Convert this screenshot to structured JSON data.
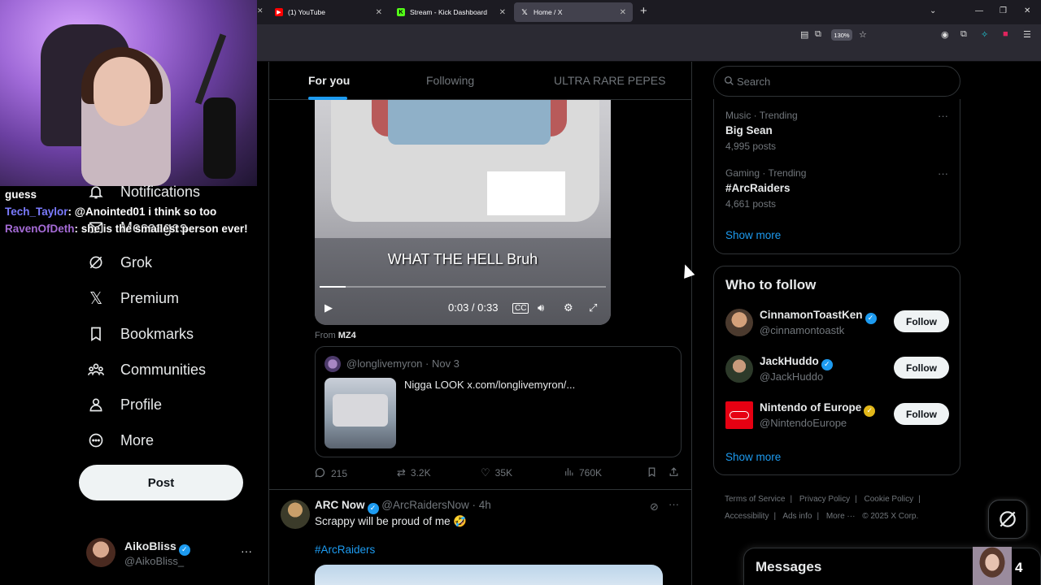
{
  "browser": {
    "tabs": [
      {
        "label": "(1) YouTube",
        "icon": "youtube-icon",
        "color": "#ff0000"
      },
      {
        "label": "Stream - Kick Dashboard",
        "icon": "kick-icon",
        "color": "#53fc18"
      },
      {
        "label": "Home / X",
        "icon": "x-logo-icon",
        "color": "#ffffff"
      }
    ],
    "zoom": "130%"
  },
  "chat": [
    {
      "user": "",
      "text": "guess"
    },
    {
      "user": "Tech_Taylor",
      "text": "@Anointed01 i think so too"
    },
    {
      "user": "RavenOfDeth",
      "text": "she is the smallest person ever!"
    }
  ],
  "nav": {
    "items": [
      {
        "label": "Notifications",
        "icon": "bell-icon"
      },
      {
        "label": "Messages",
        "icon": "envelope-icon"
      },
      {
        "label": "Grok",
        "icon": "grok-icon"
      },
      {
        "label": "Premium",
        "icon": "x-logo-icon"
      },
      {
        "label": "Bookmarks",
        "icon": "bookmark-icon"
      },
      {
        "label": "Communities",
        "icon": "people-icon"
      },
      {
        "label": "Profile",
        "icon": "person-icon"
      },
      {
        "label": "More",
        "icon": "more-circle-icon"
      }
    ],
    "post_label": "Post",
    "account": {
      "name": "AikoBliss",
      "handle": "@AikoBliss_"
    }
  },
  "timeline": {
    "tabs": [
      "For you",
      "Following",
      "ULTRA RARE PEPES"
    ],
    "active_tab": 0,
    "video": {
      "caption": "WHAT THE HELL Bruh",
      "time": "0:03 / 0:33",
      "progress": 0.09
    },
    "from_prefix": "From",
    "from_account": "MZ4",
    "quote": {
      "head": "@longlivemyron · Nov 3",
      "text": "Nigga LOOK  x.com/longlivemyron/..."
    },
    "stats": {
      "replies": "215",
      "reposts": "3.2K",
      "likes": "35K",
      "views": "760K"
    },
    "tweet2": {
      "name": "ARC Now",
      "handle": "@ArcRaidersNow · 4h",
      "text": "Scrappy will be proud of me 🤣",
      "hashtag": "#ArcRaiders"
    }
  },
  "sidebar": {
    "search_placeholder": "Search",
    "trends": [
      {
        "category": "Music · Trending",
        "name": "Big Sean",
        "posts": "4,995 posts"
      },
      {
        "category": "Gaming · Trending",
        "name": "#ArcRaiders",
        "posts": "4,661 posts"
      }
    ],
    "trends_show_more": "Show more",
    "who_to_follow_title": "Who to follow",
    "who_to_follow": [
      {
        "name": "CinnamonToastKen",
        "handle": "@cinnamontoastk",
        "badge": "blue"
      },
      {
        "name": "JackHuddo",
        "handle": "@JackHuddo",
        "badge": "blue"
      },
      {
        "name": "Nintendo of Europe",
        "handle": "@NintendoEurope",
        "badge": "gold"
      }
    ],
    "follow_label": "Follow",
    "wtf_show_more": "Show more",
    "footer": [
      "Terms of Service",
      "|",
      "Privacy Policy",
      "|",
      "Cookie Policy",
      "|",
      "Accessibility",
      "|",
      "Ads info",
      "|",
      "More ···",
      "© 2025 X Corp."
    ]
  },
  "messages_drawer": {
    "title": "Messages",
    "count": "4"
  }
}
